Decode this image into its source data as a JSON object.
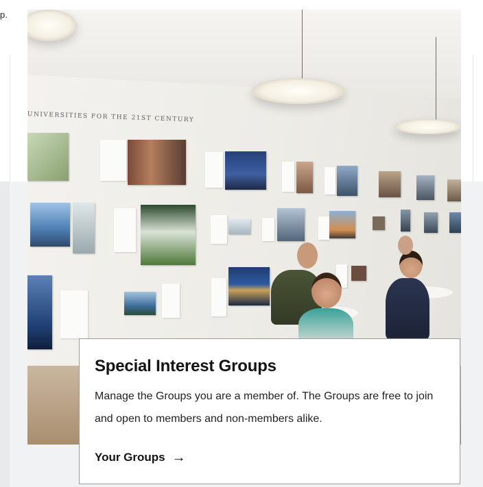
{
  "page": {
    "left_fragment_text": "p."
  },
  "photo": {
    "alt": "Exhibition hall with wall of architectural photos and people sitting at tables",
    "wall_title": "UNIVERSITIES FOR THE 21ST CENTURY"
  },
  "card": {
    "title": "Special Interest Groups",
    "description": "Manage the Groups you are a member of. The Groups are free to join and open to members and non-members alike.",
    "link_label": "Your Groups",
    "link_icon": "arrow-right-icon"
  }
}
